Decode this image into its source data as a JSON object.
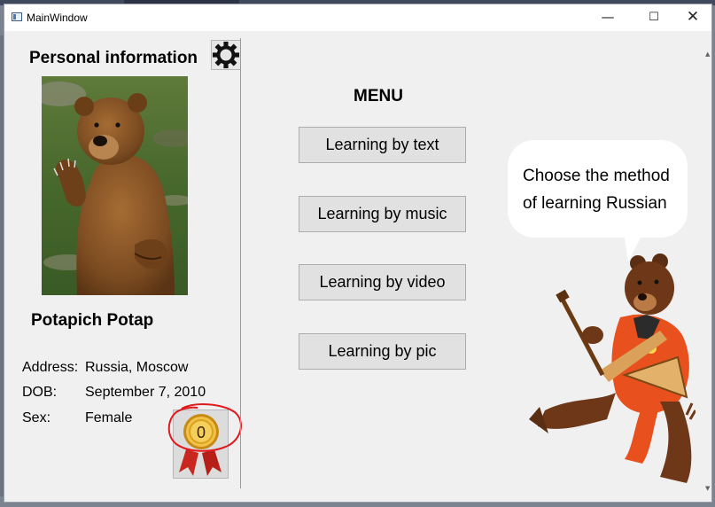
{
  "window": {
    "title": "MainWindow",
    "controls": {
      "minimize": "—",
      "maximize": "☐",
      "close": "✕"
    }
  },
  "profile": {
    "heading": "Personal information",
    "settings_icon": "gear-icon",
    "name": "Potapich Potap",
    "address_label": "Address:",
    "address_value": "Russia, Moscow",
    "dob_label": "DOB:",
    "dob_value": "September 7, 2010",
    "sex_label": "Sex:",
    "sex_value": "Female",
    "medal_count": "0"
  },
  "menu": {
    "title": "MENU",
    "buttons": [
      {
        "label": "Learning by text"
      },
      {
        "label": "Learning by music"
      },
      {
        "label": "Learning by video"
      },
      {
        "label": "Learning by pic"
      }
    ]
  },
  "mascot": {
    "speech_line1": "Choose the method",
    "speech_line2": "of learning Russian"
  },
  "colors": {
    "window_bg": "#f0f0f0",
    "button_bg": "#e1e1e1",
    "annotation_red": "#e0191c",
    "medal_gold": "#d9a21a",
    "ribbon_red": "#c8261e"
  }
}
